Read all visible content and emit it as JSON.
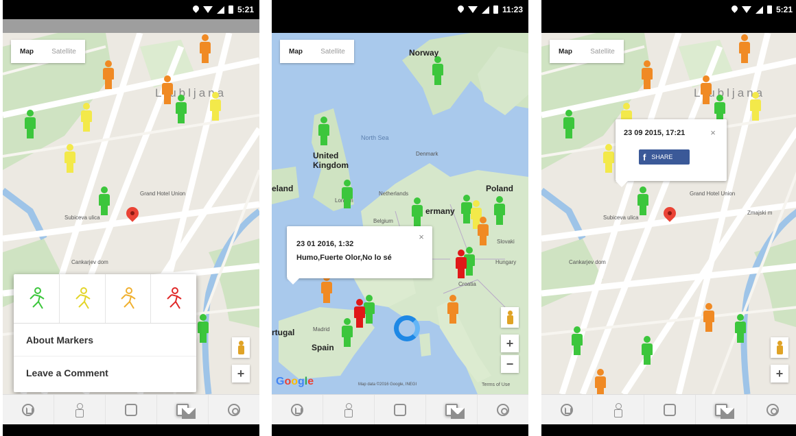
{
  "screens": [
    {
      "status": {
        "time": "5:21"
      },
      "map_type": {
        "map": "Map",
        "satellite": "Satellite"
      },
      "labels": {
        "city": "Ljubljana",
        "street1": "Grand Hotel Union",
        "street2": "Cankarjev dom",
        "street3": "Subiceva ulica"
      },
      "zoom": {
        "plus": "+"
      },
      "popup_menu": {
        "about": "About Markers",
        "comment": "Leave a Comment"
      }
    },
    {
      "status": {
        "time": "11:23"
      },
      "map_type": {
        "map": "Map",
        "satellite": "Satellite"
      },
      "labels": {
        "norway": "Norway",
        "uk": "United\nKingdom",
        "ireland": "eland",
        "poland": "Poland",
        "germany": "ermany",
        "netherlands": "Netherlands",
        "belgium": "Belgium",
        "denmark": "Denmark",
        "north_sea": "North Sea",
        "portugal": "rtugal",
        "spain": "Spain",
        "madrid": "Madrid",
        "hungary": "Hungary",
        "slovakia": "Slovaki",
        "croatia": "Croatia",
        "london": "London",
        "map_data": "Map data ©2016 Google, INEGI",
        "terms": "Terms of Use"
      },
      "info_window": {
        "date": "23 01 2016, 1:32",
        "text": "Humo,Fuerte Olor,No lo sé",
        "close": "×"
      },
      "google": [
        "G",
        "o",
        "o",
        "g",
        "l",
        "e"
      ],
      "zoom": {
        "plus": "+",
        "minus": "−"
      }
    },
    {
      "status": {
        "time": "5:21"
      },
      "map_type": {
        "map": "Map",
        "satellite": "Satellite"
      },
      "labels": {
        "city": "Ljubljana",
        "street1": "Grand Hotel Union",
        "street2": "Cankarjev dom",
        "street3": "Subiceva ulica",
        "street4": "Zmajski m"
      },
      "info_window": {
        "date": "23 09 2015, 17:21",
        "close": "×",
        "share": "SHARE"
      },
      "zoom": {
        "plus": "+"
      }
    }
  ],
  "colors": {
    "green": "#3cc63c",
    "yellow": "#f3e94a",
    "orange": "#f08a24",
    "red": "#e01818",
    "water": "#a9c9ec",
    "land_city": "#ece9e2"
  },
  "icons": [
    "home-icon",
    "marker-person-icon",
    "shirt-icon",
    "info-icon",
    "settings-icon"
  ]
}
